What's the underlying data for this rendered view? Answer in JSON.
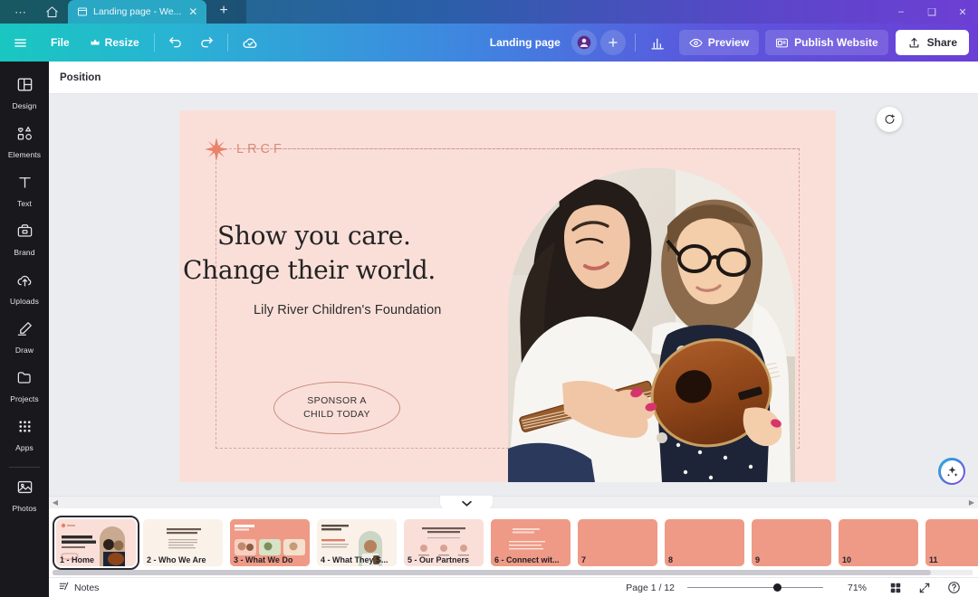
{
  "titlebar": {
    "dots_icon": "more-dots-icon",
    "home_icon": "home-icon",
    "tab": {
      "icon": "document-icon",
      "title": "Landing page - We...",
      "close_icon": "close-icon"
    },
    "new_tab_label": "+",
    "window_controls": {
      "minimize": "minimize-icon",
      "maximize": "maximize-icon",
      "close": "close-icon"
    }
  },
  "toolbar": {
    "menu_icon": "hamburger-menu-icon",
    "file_label": "File",
    "resize_label": "Resize",
    "resize_badge_icon": "crown-icon",
    "undo_icon": "undo-icon",
    "redo_icon": "redo-icon",
    "cloud_icon": "cloud-saved-icon",
    "doc_title": "Landing page",
    "avatar_icon": "user-avatar-icon",
    "add_collaborator_icon": "plus-icon",
    "analytics_icon": "bar-chart-icon",
    "preview_label": "Preview",
    "preview_icon": "eye-icon",
    "publish_label": "Publish Website",
    "publish_icon": "website-icon",
    "share_label": "Share",
    "share_icon": "share-upload-icon"
  },
  "sidebar": {
    "items": [
      {
        "label": "Design",
        "icon": "design-layout-icon"
      },
      {
        "label": "Elements",
        "icon": "elements-shapes-icon"
      },
      {
        "label": "Text",
        "icon": "text-t-icon"
      },
      {
        "label": "Brand",
        "icon": "brand-kit-icon"
      },
      {
        "label": "Uploads",
        "icon": "upload-cloud-icon"
      },
      {
        "label": "Draw",
        "icon": "draw-pen-icon"
      },
      {
        "label": "Projects",
        "icon": "folder-icon"
      },
      {
        "label": "Apps",
        "icon": "apps-grid-icon"
      },
      {
        "label": "Photos",
        "icon": "photos-image-icon"
      }
    ]
  },
  "propbar": {
    "position_label": "Position"
  },
  "canvas": {
    "rotate_icon": "rotate-duplicate-icon",
    "ai_icon": "magic-sparkle-icon",
    "slide": {
      "background_color": "#fadfd9",
      "logo_text": "LRCF",
      "logo_icon": "sunburst-star-icon",
      "headline_line1": "Show you care.",
      "headline_line2": "Change their world.",
      "subheadline": "Lily River Children's Foundation",
      "cta_line1": "SPONSOR A",
      "cta_line2": "CHILD TODAY",
      "photo_alt": "woman teaching child to play ukulele"
    }
  },
  "scroll": {
    "left_arrow": "chevron-left-icon",
    "right_arrow": "chevron-right-icon",
    "collapse_icon": "chevron-down-icon"
  },
  "pages": [
    {
      "num": "1",
      "label": "1 - Home",
      "color": "#fadfd9",
      "kind": "home",
      "selected": true
    },
    {
      "num": "2",
      "label": "2 - Who We Are",
      "color": "#faf1e9",
      "kind": "text",
      "selected": false
    },
    {
      "num": "3",
      "label": "3 - What We Do",
      "color": "#ef9a86",
      "kind": "gallery",
      "selected": false
    },
    {
      "num": "4",
      "label": "4 - What They S...",
      "color": "#faf1e9",
      "kind": "portrait",
      "selected": false
    },
    {
      "num": "5",
      "label": "5 - Our Partners",
      "color": "#fadfd9",
      "kind": "partners",
      "selected": false
    },
    {
      "num": "6",
      "label": "6 - Connect wit...",
      "color": "#ef9a86",
      "kind": "contact",
      "selected": false
    },
    {
      "num": "7",
      "label": "7",
      "color": "#ef9a86",
      "kind": "blank",
      "selected": false
    },
    {
      "num": "8",
      "label": "8",
      "color": "#ef9a86",
      "kind": "blank",
      "selected": false
    },
    {
      "num": "9",
      "label": "9",
      "color": "#ef9a86",
      "kind": "blank",
      "selected": false
    },
    {
      "num": "10",
      "label": "10",
      "color": "#ef9a86",
      "kind": "blank",
      "selected": false
    },
    {
      "num": "11",
      "label": "11",
      "color": "#ef9a86",
      "kind": "blank",
      "selected": false
    }
  ],
  "statusbar": {
    "notes_label": "Notes",
    "notes_icon": "notes-icon",
    "page_indicator": "Page 1 / 12",
    "zoom_level": "71%",
    "zoom_slider_percent": 63,
    "grid_icon": "grid-view-icon",
    "fullscreen_icon": "fullscreen-icon",
    "help_icon": "help-question-icon"
  },
  "colors": {
    "brand_pink": "#fadfd9",
    "brand_coral": "#ef9a86",
    "accent_purple": "#6b3fd6",
    "accent_teal": "#19c7c0"
  }
}
